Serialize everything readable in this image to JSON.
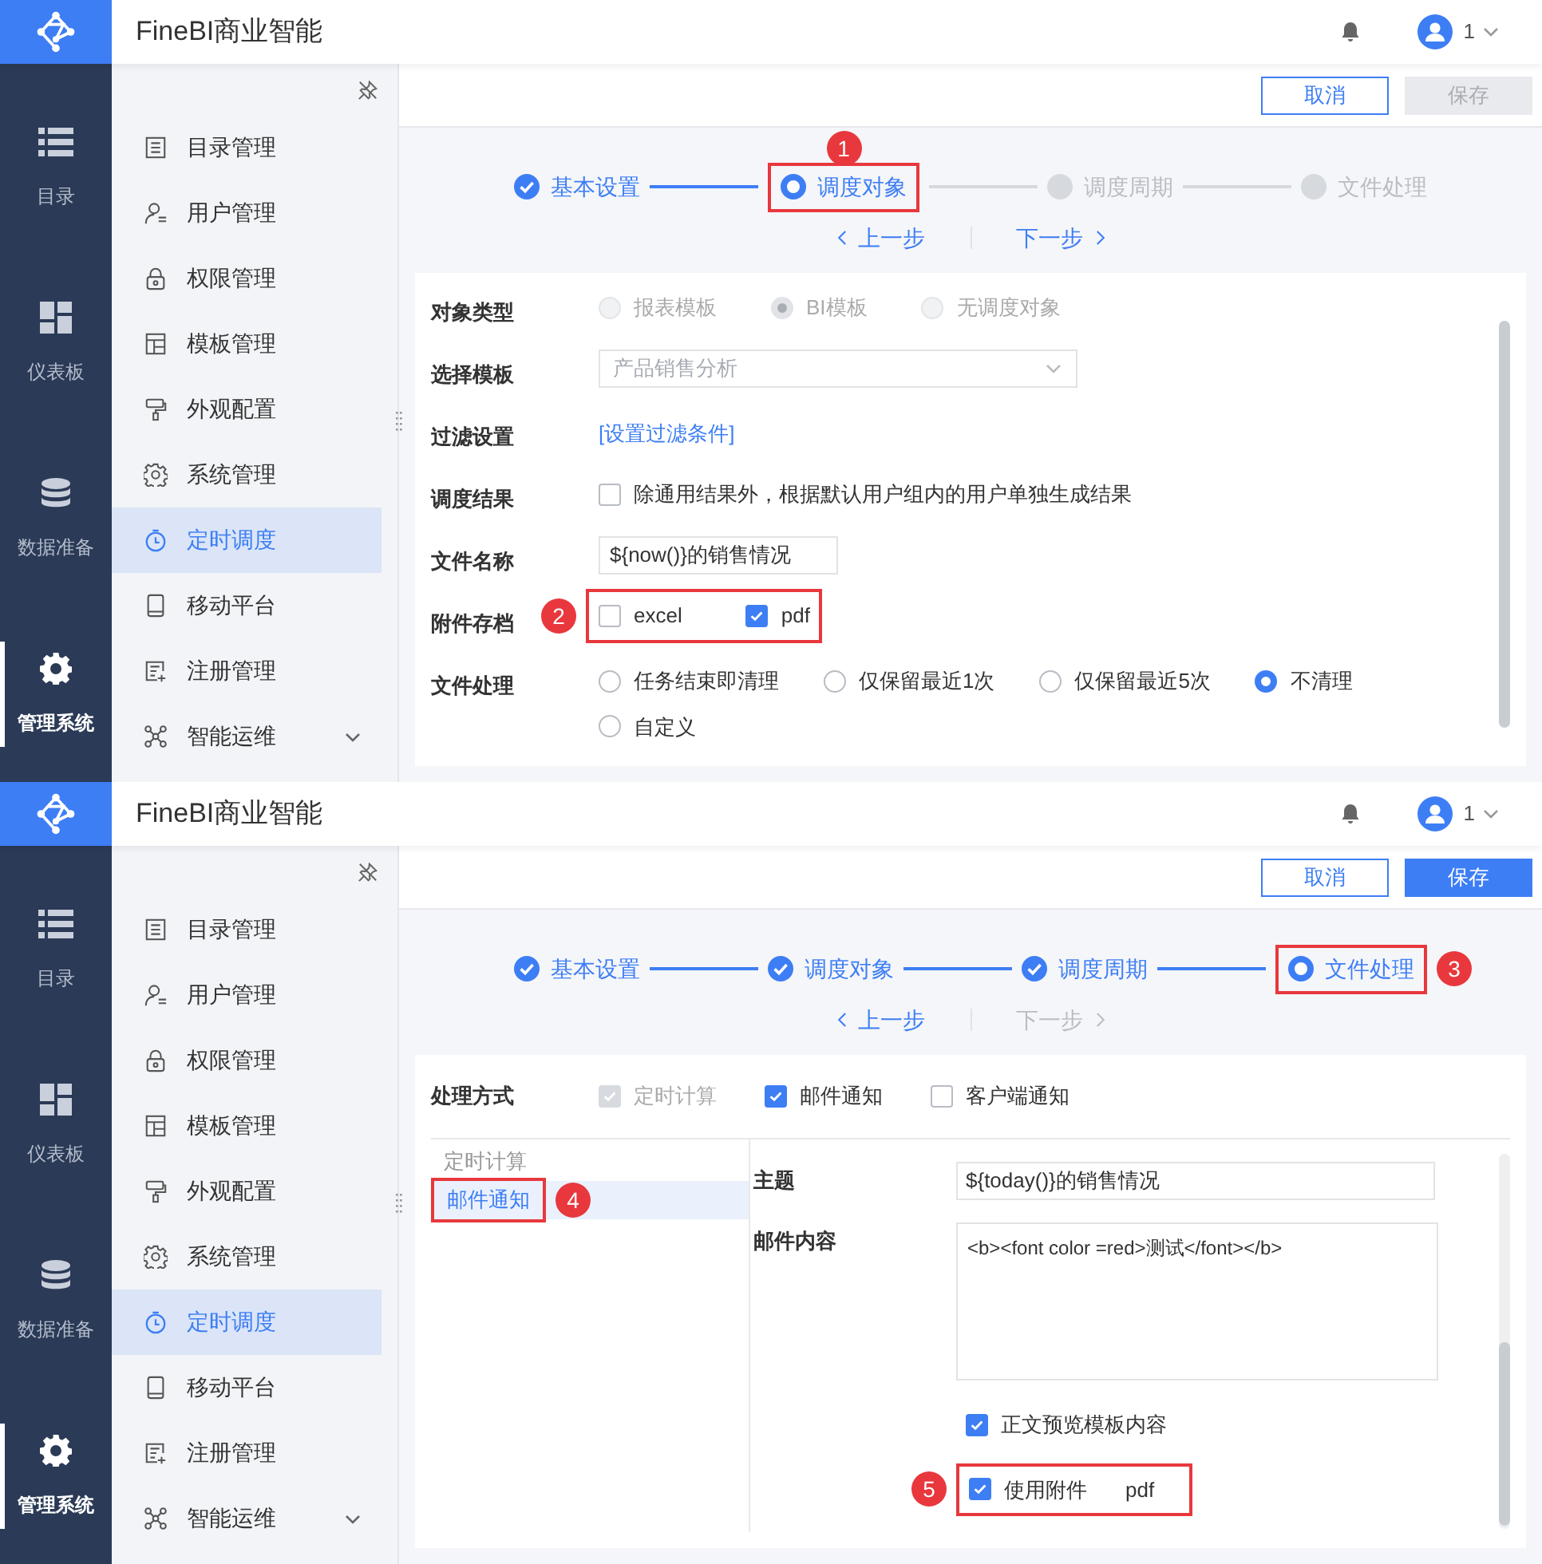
{
  "screens": [
    {
      "header": {
        "title": "FineBI商业智能",
        "user": "1"
      },
      "rail": [
        {
          "label": "目录",
          "selected": false
        },
        {
          "label": "仪表板",
          "selected": false
        },
        {
          "label": "数据准备",
          "selected": false
        },
        {
          "label": "管理系统",
          "selected": true
        }
      ],
      "nav": [
        {
          "label": "目录管理",
          "selected": false,
          "expandable": false
        },
        {
          "label": "用户管理",
          "selected": false,
          "expandable": false
        },
        {
          "label": "权限管理",
          "selected": false,
          "expandable": false
        },
        {
          "label": "模板管理",
          "selected": false,
          "expandable": false
        },
        {
          "label": "外观配置",
          "selected": false,
          "expandable": false
        },
        {
          "label": "系统管理",
          "selected": false,
          "expandable": false
        },
        {
          "label": "定时调度",
          "selected": true,
          "expandable": false
        },
        {
          "label": "移动平台",
          "selected": false,
          "expandable": false
        },
        {
          "label": "注册管理",
          "selected": false,
          "expandable": false
        },
        {
          "label": "智能运维",
          "selected": false,
          "expandable": true
        }
      ],
      "actions": [
        {
          "label": "取消",
          "kind": "secondary",
          "disabled": false
        },
        {
          "label": "保存",
          "kind": "primary",
          "disabled": true
        }
      ],
      "steps": [
        {
          "label": "基本设置",
          "completed": true,
          "selected": false
        },
        {
          "label": "调度对象",
          "completed": false,
          "selected": true,
          "callout": "1"
        },
        {
          "label": "调度周期",
          "completed": false,
          "selected": false
        },
        {
          "label": "文件处理",
          "completed": false,
          "selected": false
        }
      ],
      "prev": {
        "label": "上一步",
        "disabled": false
      },
      "next": {
        "label": "下一步",
        "disabled": false
      },
      "form": {
        "kind": "object",
        "fields": [
          {
            "kind": "radio",
            "label": "对象类型",
            "disabled": true,
            "options": [
              {
                "label": "报表模板",
                "selected": false
              },
              {
                "label": "BI模板",
                "selected": true
              },
              {
                "label": "无调度对象",
                "selected": false
              }
            ]
          },
          {
            "kind": "select",
            "label": "选择模板",
            "value": "产品销售分析",
            "disabled": true
          },
          {
            "kind": "link",
            "label": "过滤设置",
            "text": "[设置过滤条件]"
          },
          {
            "kind": "checkbox",
            "label": "调度结果",
            "options": [
              {
                "label": "除通用结果外，根据默认用户组内的用户单独生成结果",
                "checked": false
              }
            ]
          },
          {
            "kind": "text",
            "label": "文件名称",
            "value": "${now()}的销售情况"
          },
          {
            "kind": "checkbox",
            "label": "附件存档",
            "callout": "2",
            "options": [
              {
                "label": "excel",
                "checked": false
              },
              {
                "label": "pdf",
                "checked": true
              }
            ]
          },
          {
            "kind": "radio",
            "label": "文件处理",
            "disabled": false,
            "options": [
              {
                "label": "任务结束即清理",
                "selected": false
              },
              {
                "label": "仅保留最近1次",
                "selected": false
              },
              {
                "label": "仅保留最近5次",
                "selected": false
              },
              {
                "label": "不清理",
                "selected": true
              },
              {
                "label": "自定义",
                "selected": false
              }
            ]
          }
        ]
      }
    },
    {
      "header": {
        "title": "FineBI商业智能",
        "user": "1"
      },
      "rail": [
        {
          "label": "目录",
          "selected": false
        },
        {
          "label": "仪表板",
          "selected": false
        },
        {
          "label": "数据准备",
          "selected": false
        },
        {
          "label": "管理系统",
          "selected": true
        }
      ],
      "nav": [
        {
          "label": "目录管理",
          "selected": false,
          "expandable": false
        },
        {
          "label": "用户管理",
          "selected": false,
          "expandable": false
        },
        {
          "label": "权限管理",
          "selected": false,
          "expandable": false
        },
        {
          "label": "模板管理",
          "selected": false,
          "expandable": false
        },
        {
          "label": "外观配置",
          "selected": false,
          "expandable": false
        },
        {
          "label": "系统管理",
          "selected": false,
          "expandable": false
        },
        {
          "label": "定时调度",
          "selected": true,
          "expandable": false
        },
        {
          "label": "移动平台",
          "selected": false,
          "expandable": false
        },
        {
          "label": "注册管理",
          "selected": false,
          "expandable": false
        },
        {
          "label": "智能运维",
          "selected": false,
          "expandable": true
        }
      ],
      "actions": [
        {
          "label": "取消",
          "kind": "secondary",
          "disabled": false
        },
        {
          "label": "保存",
          "kind": "primary",
          "disabled": false
        }
      ],
      "steps": [
        {
          "label": "基本设置",
          "completed": true,
          "selected": false
        },
        {
          "label": "调度对象",
          "completed": true,
          "selected": false
        },
        {
          "label": "调度周期",
          "completed": true,
          "selected": false
        },
        {
          "label": "文件处理",
          "completed": false,
          "selected": true,
          "callout": "3"
        }
      ],
      "prev": {
        "label": "上一步",
        "disabled": false
      },
      "next": {
        "label": "下一步",
        "disabled": true
      },
      "form": {
        "kind": "mail",
        "method": {
          "label": "处理方式",
          "options": [
            {
              "label": "定时计算",
              "checked": true,
              "disabled": true
            },
            {
              "label": "邮件通知",
              "checked": true,
              "disabled": false
            },
            {
              "label": "客户端通知",
              "checked": false,
              "disabled": false
            }
          ]
        },
        "tabs": [
          {
            "label": "定时计算",
            "selected": false
          },
          {
            "label": "邮件通知",
            "selected": true,
            "callout": "4"
          }
        ],
        "subject": {
          "label": "主题",
          "value": "${today()}的销售情况"
        },
        "content": {
          "label": "邮件内容",
          "value": "<b><font color =red>测试</font></b>"
        },
        "options": [
          {
            "label": "正文预览模板内容",
            "checked": true
          },
          {
            "label": "使用附件",
            "checked": true,
            "suffix": "pdf",
            "callout": "5"
          }
        ]
      }
    }
  ]
}
